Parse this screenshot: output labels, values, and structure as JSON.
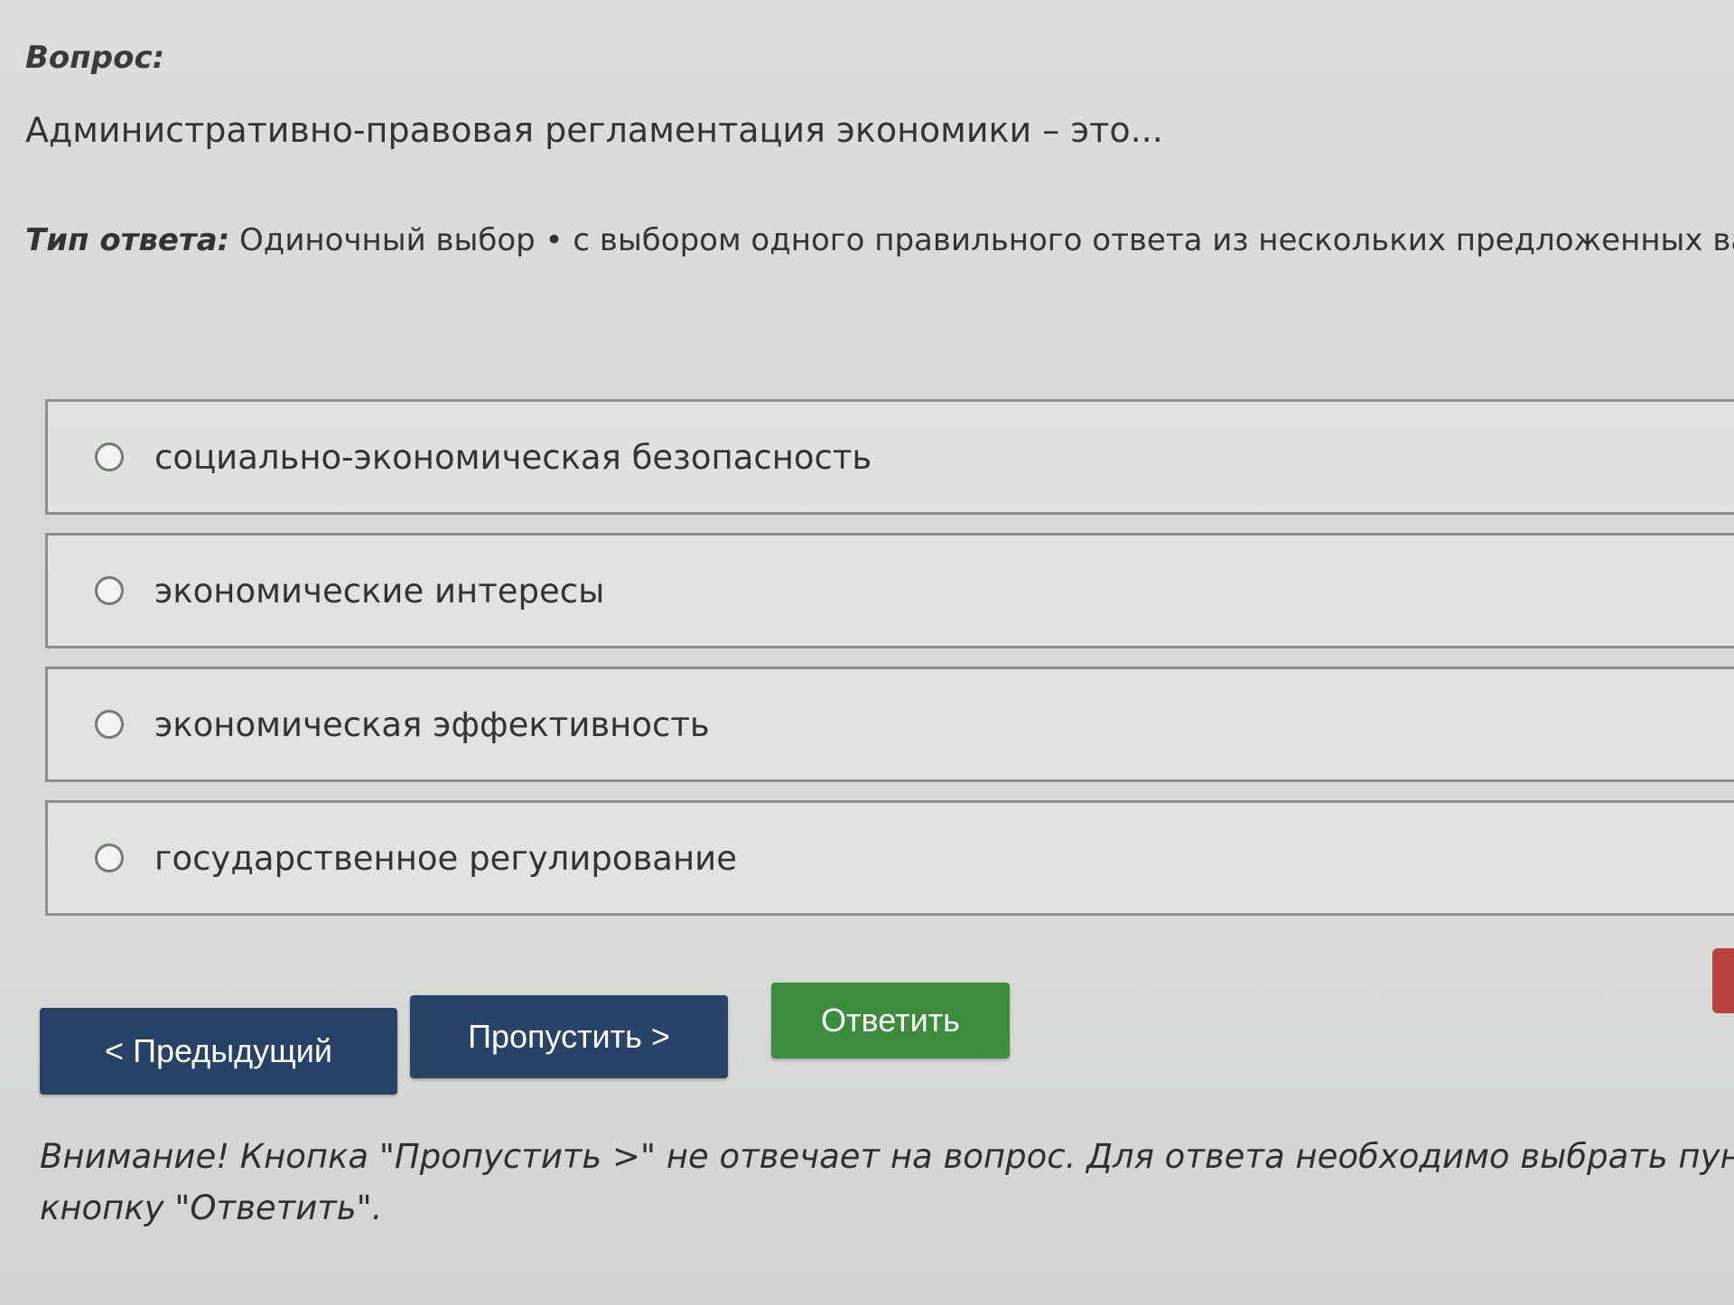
{
  "question": {
    "label": "Вопрос:",
    "text": "Административно-правовая регламентация экономики – это..."
  },
  "answer_type": {
    "label": "Тип ответа:",
    "value": "Одиночный выбор • с выбором одного правильного ответа из нескольких предложенных вариантов"
  },
  "options": [
    {
      "label": "социально-экономическая безопасность",
      "selected": false
    },
    {
      "label": "экономические интересы",
      "selected": false
    },
    {
      "label": "экономическая эффективность",
      "selected": false
    },
    {
      "label": "государственное регулирование",
      "selected": false
    }
  ],
  "buttons": {
    "previous": "< Предыдущий",
    "skip": "Пропустить >",
    "answer": "Ответить"
  },
  "warning": {
    "line1": "Внимание! Кнопка \"Пропустить >\" не отвечает на вопрос. Для ответа необходимо выбрать пункт из списк",
    "line2": "кнопку \"Ответить\"."
  },
  "colors": {
    "primary_button": "#274267",
    "answer_button": "#3d8c3d",
    "side_accent": "#b84040"
  }
}
